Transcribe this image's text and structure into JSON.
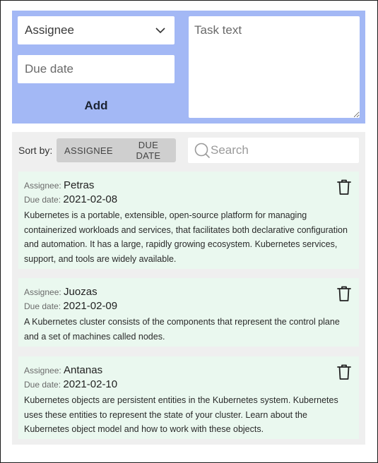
{
  "form": {
    "assignee_select": {
      "selected": "Assignee"
    },
    "due_date": {
      "placeholder": "Due date"
    },
    "add_label": "Add",
    "task_text": {
      "placeholder": "Task text"
    }
  },
  "list": {
    "sort_label": "Sort by:",
    "sort_buttons": [
      "ASSIGNEE",
      "DUE DATE"
    ],
    "search": {
      "placeholder": "Search"
    },
    "assignee_label": "Assignee:",
    "due_label": "Due date:",
    "tasks": [
      {
        "assignee": "Petras",
        "due": "2021-02-08",
        "text": "Kubernetes is a portable, extensible, open-source platform for managing containerized workloads and services, that facilitates both declarative configuration and automation. It has a large, rapidly growing ecosystem. Kubernetes services, support, and tools are widely available."
      },
      {
        "assignee": "Juozas",
        "due": "2021-02-09",
        "text": "A Kubernetes cluster consists of the components that represent the control plane and a set of machines called nodes."
      },
      {
        "assignee": "Antanas",
        "due": "2021-02-10",
        "text": "Kubernetes objects are persistent entities in the Kubernetes system. Kubernetes uses these entities to represent the state of your cluster. Learn about the Kubernetes object model and how to work with these objects."
      }
    ]
  },
  "icons": {
    "dropdown": "chevron-down-icon",
    "search": "search-icon",
    "delete": "trash-icon"
  },
  "colors": {
    "form_panel_bg": "#a3b8f5",
    "list_panel_bg": "#efefef",
    "card_bg": "#eaf8ef",
    "sort_group_bg": "#cfcfcf"
  }
}
